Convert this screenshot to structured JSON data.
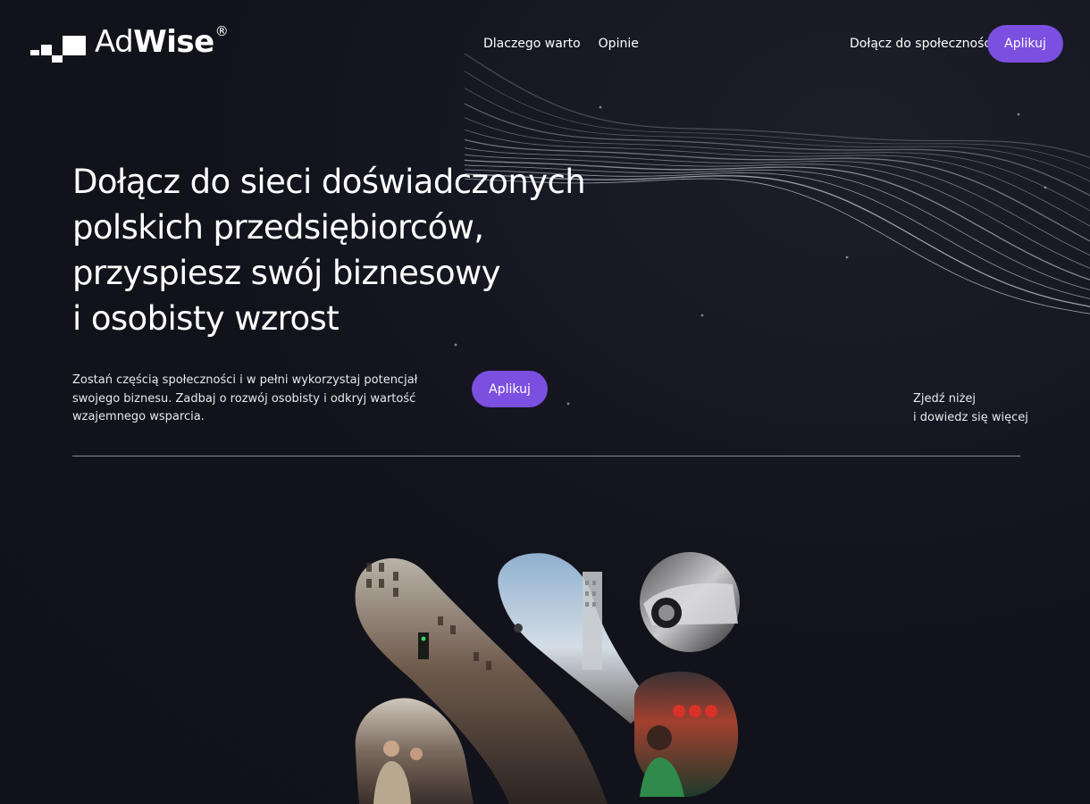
{
  "brand": {
    "name_light": "Ad",
    "name_heavy": "Wise",
    "registered": "®"
  },
  "nav": {
    "items": [
      {
        "label": "Dlaczego warto"
      },
      {
        "label": "Opinie"
      }
    ],
    "join_label": "Dołącz do społeczności",
    "apply_label": "Aplikuj"
  },
  "hero": {
    "title_lines": [
      "Dołącz do sieci doświadczonych",
      "polskich przedsiębiorców,",
      "przyspiesz swój biznesowy",
      "i osobisty wzrost"
    ],
    "description": "Zostań częścią społeczności i w pełni wykorzystaj potencjał swojego biznesu. Zadbaj o rozwój osobisty i odkryj wartość wzajemnego wsparcia.",
    "apply_label": "Aplikuj",
    "scroll_hint_lines": [
      "Zjedź niżej",
      "i dowiedz się więcej"
    ]
  },
  "colors": {
    "background": "#12121b",
    "accent": "#7b4fe0",
    "text": "#ffffff"
  }
}
